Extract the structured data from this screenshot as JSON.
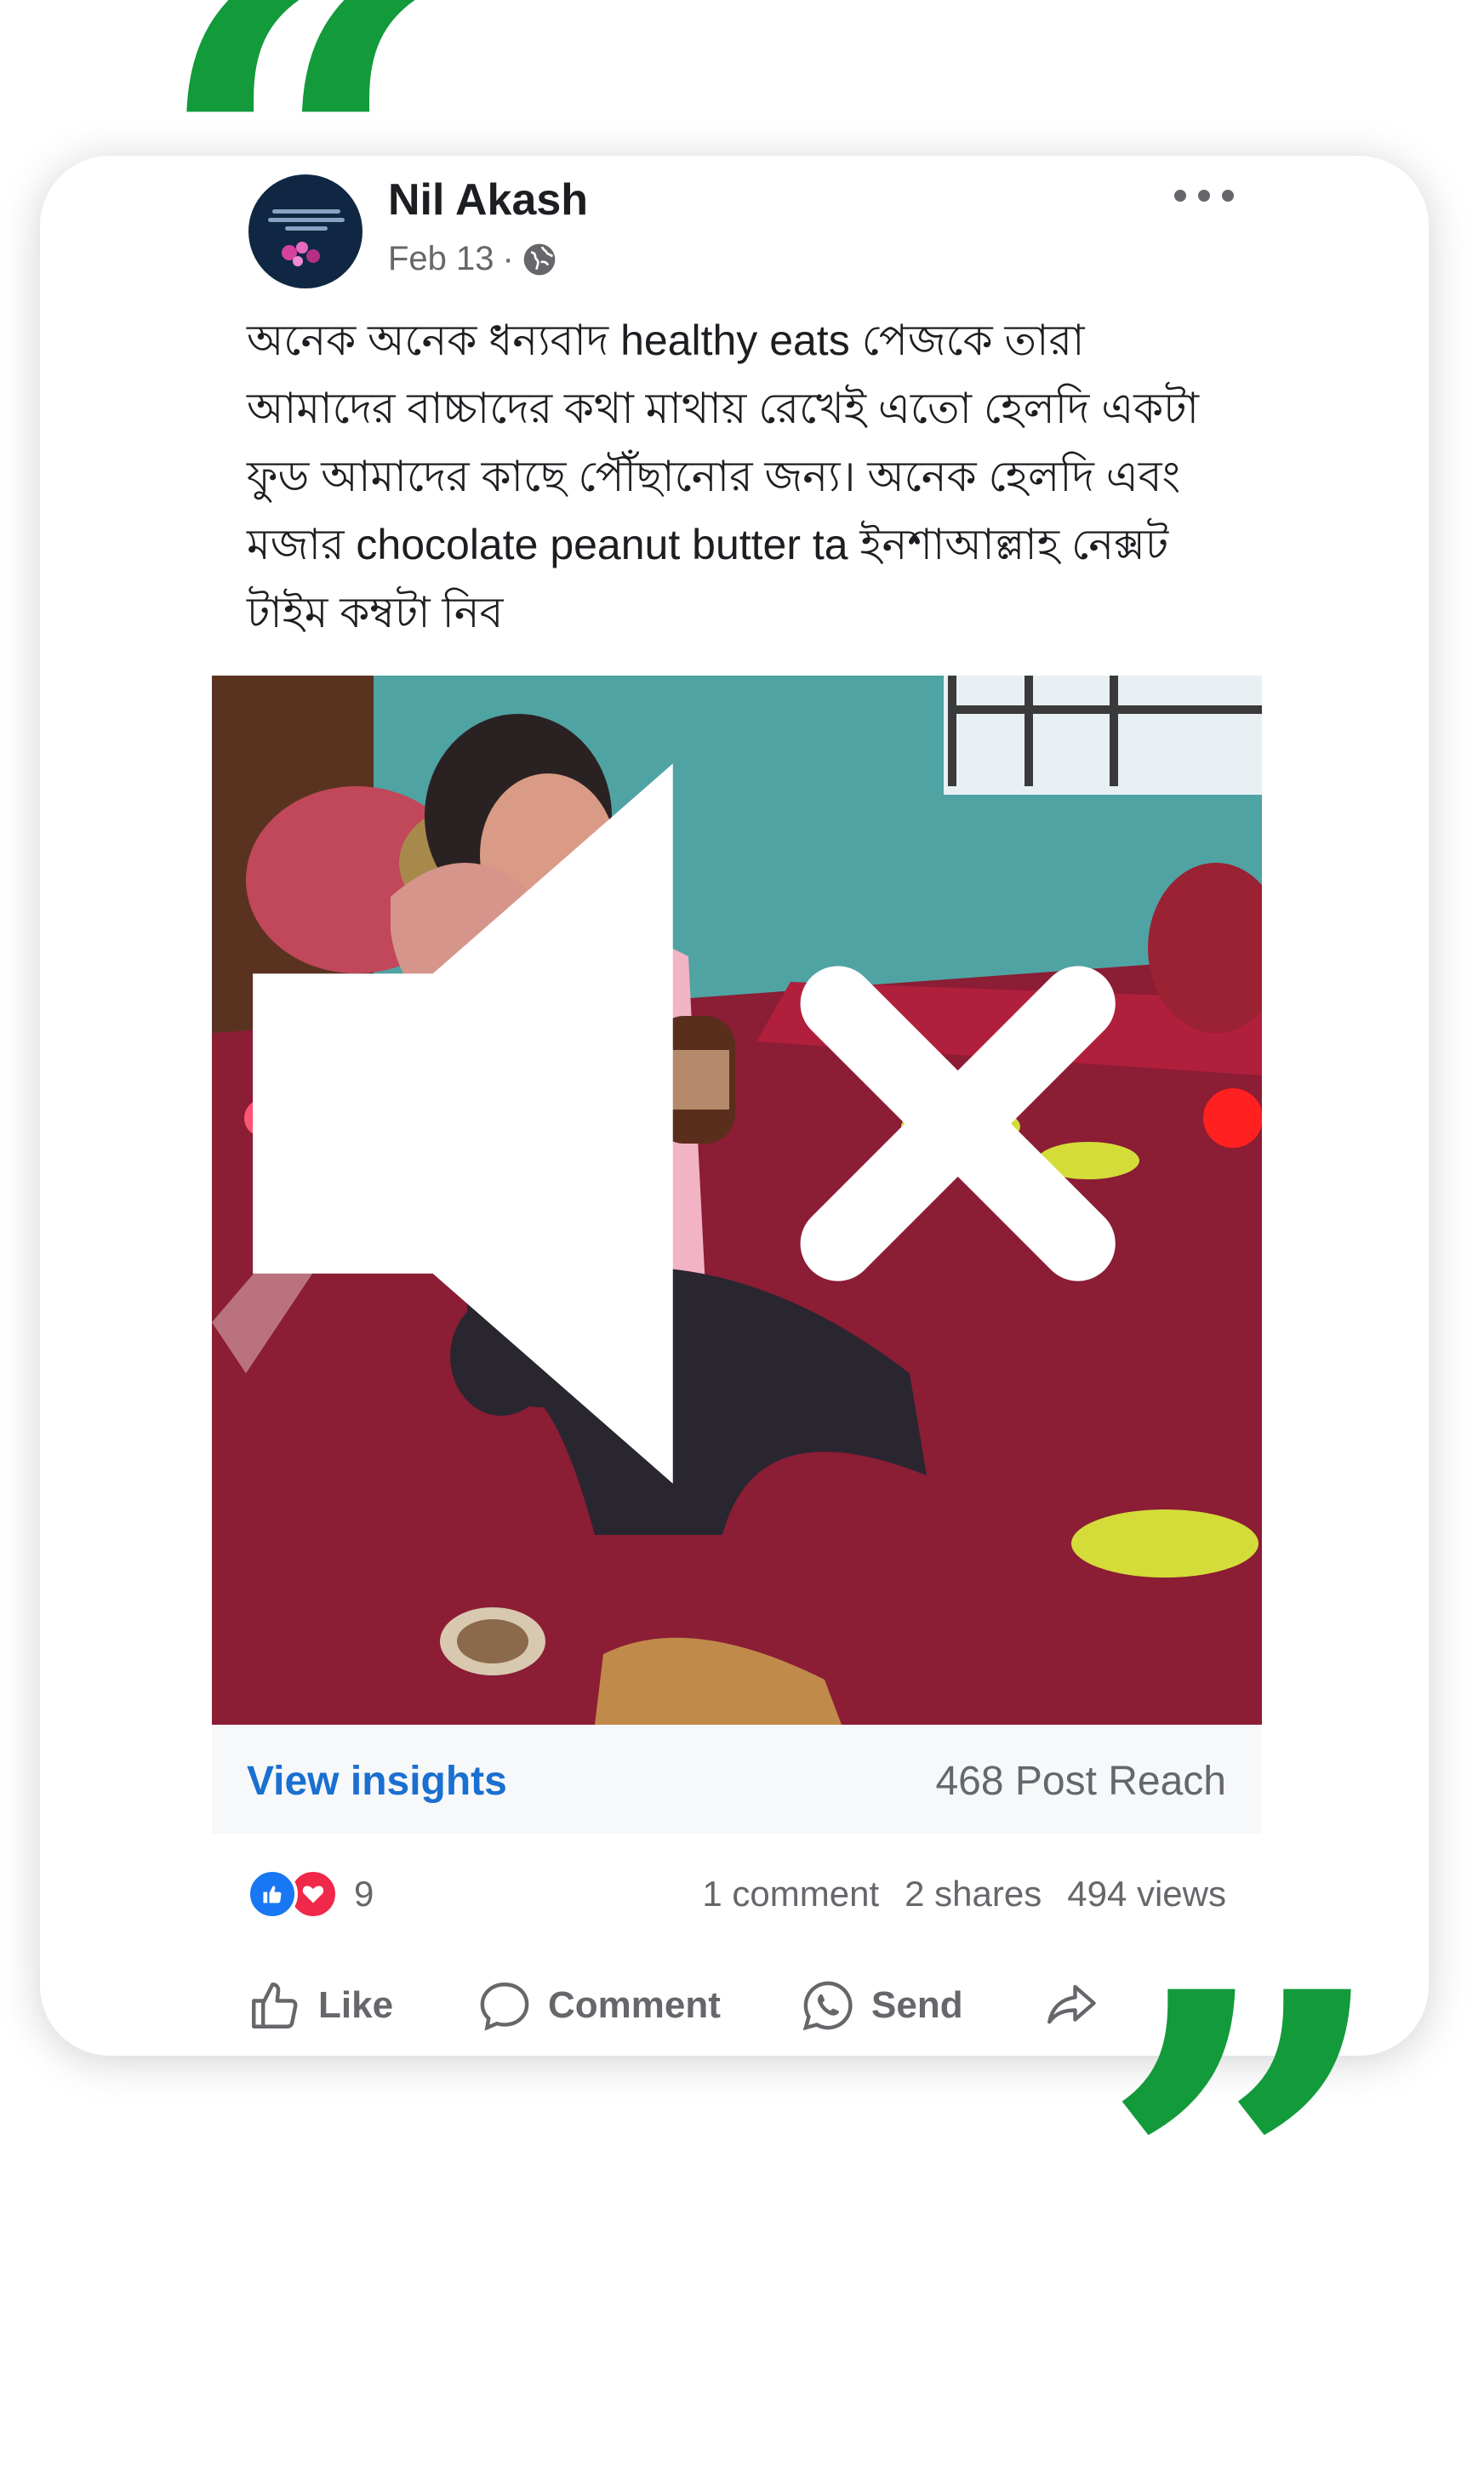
{
  "colors": {
    "quote_green": "#129a3b",
    "link_blue": "#1a6fd1",
    "like_blue": "#1877f2",
    "love_red": "#f02849"
  },
  "decor": {
    "open_quote": "“",
    "close_quote": "”"
  },
  "post": {
    "author": "Nil Akash",
    "date": "Feb 13",
    "separator": "·",
    "audience_icon": "globe-icon",
    "more_icon": "more-dots-icon",
    "text": "অনেক অনেক ধন্যবাদ healthy eats পেজকে তারা আমাদের বাচ্চাদের কথা মাথায় রেখেই এতো হেলদি একটা ফুড আমাদের কাছে পৌঁছানোর জন্য। অনেক হেলদি এবং মজার chocolate peanut butter ta ইনশাআল্লাহ নেক্সট টাইম কম্বটা নিব",
    "media": {
      "type": "video",
      "description_icon": "muted-speaker-icon"
    }
  },
  "insights": {
    "link_label": "View insights",
    "reach_label": "468 Post Reach"
  },
  "engagement": {
    "reaction_count": "9",
    "comments": "1 comment",
    "shares": "2 shares",
    "views": "494 views"
  },
  "actions": {
    "like": "Like",
    "comment": "Comment",
    "send": "Send"
  }
}
